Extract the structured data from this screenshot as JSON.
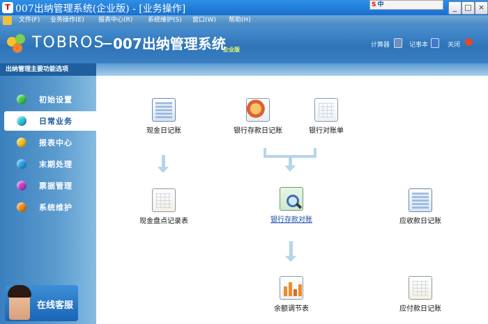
{
  "window": {
    "title": "007出纳管理系统(企业版) - [业务操作]",
    "ime_label": "中"
  },
  "menu": {
    "items": [
      {
        "label": "文件(F)"
      },
      {
        "label": "业务操作(E)"
      },
      {
        "label": "报表中心(R)"
      },
      {
        "label": "系统维护(S)"
      },
      {
        "label": "窗口(W)"
      },
      {
        "label": "帮助(H)"
      }
    ]
  },
  "header": {
    "brand": "TOBROS",
    "product": "007出纳管理系统",
    "edition": "企业版",
    "links": [
      {
        "label": "计算器",
        "icon": "calculator-icon"
      },
      {
        "label": "记事本",
        "icon": "notepad-icon"
      },
      {
        "label": "关闭",
        "icon": "close-icon"
      }
    ]
  },
  "sidebar": {
    "heading": "出纳管理主要功能选项",
    "items": [
      {
        "label": "初始设置",
        "color": "#3cc84a"
      },
      {
        "label": "日常业务",
        "color": "#28c3d8",
        "active": true
      },
      {
        "label": "报表中心",
        "color": "#f0c020"
      },
      {
        "label": "末期处理",
        "color": "#2a9ee8"
      },
      {
        "label": "票据管理",
        "color": "#c040c8"
      },
      {
        "label": "系统维护",
        "color": "#f08a1a"
      }
    ],
    "support_label": "在线客服"
  },
  "flow": {
    "nodes": [
      {
        "label": "现金日记账",
        "icon": "cash-journal-icon"
      },
      {
        "label": "银行存款日记账",
        "icon": "bank-deposit-journal-icon"
      },
      {
        "label": "银行对账单",
        "icon": "bank-statement-icon"
      },
      {
        "label": "现金盘点记录表",
        "icon": "cash-count-sheet-icon"
      },
      {
        "label": "银行存款对账",
        "icon": "bank-reconcile-icon"
      },
      {
        "label": "应收款日记账",
        "icon": "receivable-journal-icon"
      },
      {
        "label": "余额调节表",
        "icon": "balance-adjust-icon"
      },
      {
        "label": "应付款日记账",
        "icon": "payable-journal-icon"
      }
    ]
  }
}
